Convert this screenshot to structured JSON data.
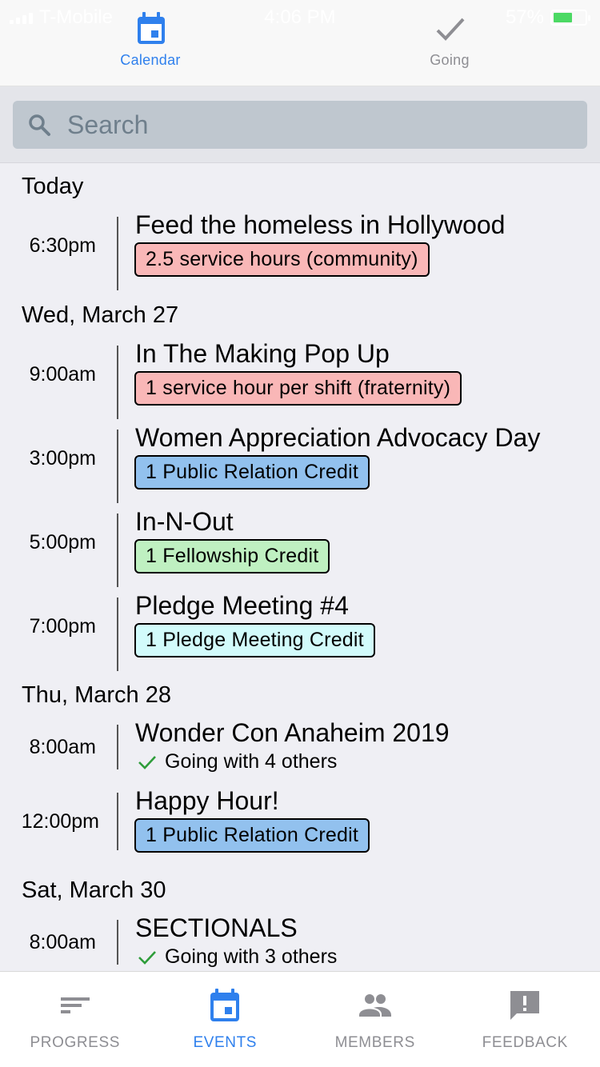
{
  "status_bar": {
    "carrier": "T-Mobile",
    "time": "4:06 PM",
    "battery": "57%"
  },
  "top_tabs": [
    {
      "label": "Calendar",
      "icon": "calendar-icon",
      "active": true
    },
    {
      "label": "Going",
      "icon": "checkmark-icon",
      "active": false
    }
  ],
  "search": {
    "placeholder": "Search",
    "value": ""
  },
  "days": [
    {
      "label": "Today"
    },
    {
      "label": "Wed, March 27"
    },
    {
      "label": "Thu, March 28"
    },
    {
      "label": "Sat, March 30"
    }
  ],
  "events": [
    {
      "time": "6:30pm",
      "title": "Feed the homeless in Hollywood",
      "badge": "2.5 service hours (community)",
      "badge_color": "#f9b7b7"
    },
    {
      "time": "9:00am",
      "title": "In The Making Pop Up",
      "badge": "1 service hour per shift (fraternity)",
      "badge_color": "#f9b7b7"
    },
    {
      "time": "3:00pm",
      "title": "Women Appreciation Advocacy Day",
      "badge": "1 Public Relation Credit",
      "badge_color": "#92c1ee"
    },
    {
      "time": "5:00pm",
      "title": "In-N-Out",
      "badge": "1 Fellowship Credit",
      "badge_color": "#bff0c1"
    },
    {
      "time": "7:00pm",
      "title": "Pledge Meeting #4",
      "badge": "1 Pledge Meeting Credit",
      "badge_color": "#d2fbfb"
    },
    {
      "time": "8:00am",
      "title": "Wonder Con Anaheim 2019",
      "going": "Going with 4 others"
    },
    {
      "time": "12:00pm",
      "title": "Happy Hour!",
      "badge": "1 Public Relation Credit",
      "badge_color": "#92c1ee"
    },
    {
      "time": "8:00am",
      "title": "SECTIONALS",
      "going": "Going with 3 others"
    }
  ],
  "bottom_nav": [
    {
      "label": "PROGRESS",
      "icon": "progress-icon",
      "active": false
    },
    {
      "label": "EVENTS",
      "icon": "calendar-icon",
      "active": true
    },
    {
      "label": "MEMBERS",
      "icon": "members-icon",
      "active": false
    },
    {
      "label": "FEEDBACK",
      "icon": "feedback-icon",
      "active": false
    }
  ],
  "colors": {
    "accent": "#2f80ed",
    "inactive": "#8e8e93",
    "check": "#2e9d3a"
  }
}
